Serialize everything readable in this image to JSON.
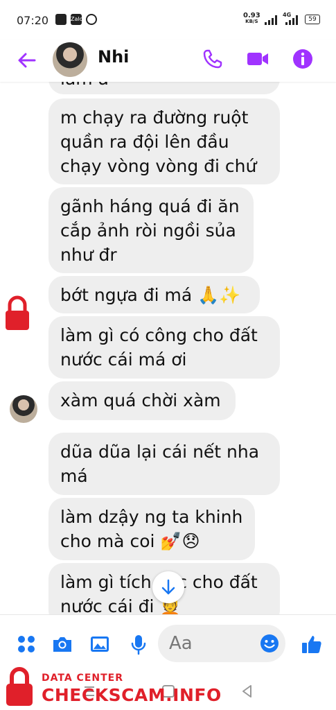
{
  "status_bar": {
    "time": "07:20",
    "net_speed_value": "0.93",
    "net_speed_unit": "KB/S",
    "network_type": "4G",
    "battery": "59"
  },
  "header": {
    "contact_name": "Nhi",
    "accent_color": "#a033ff"
  },
  "messages": [
    {
      "text": "làm á"
    },
    {
      "text": "m chạy ra đường ruột\nquần ra đội lên đầu\nchạy vòng vòng đi chứ"
    },
    {
      "text": "gãnh háng quá đi ăn\ncắp ảnh ròi ngồi sủa\nnhư đr"
    },
    {
      "text": "bớt ngựa đi má 🙏✨"
    },
    {
      "text": "làm gì có công cho đất\nnước cái má ơi"
    },
    {
      "text": "xàm quá chời xàm"
    },
    {
      "text": "dũa dũa lại cái nết nha\nmá"
    },
    {
      "text": "làm dzậy ng ta khinh\ncho mà coi 💅😞"
    },
    {
      "text": "làm gì tích cực cho đất\nnước cái đi 💆"
    }
  ],
  "composer": {
    "placeholder": "Aa",
    "icons": [
      "menu-icon",
      "camera-icon",
      "gallery-icon",
      "microphone-icon",
      "emoji-icon",
      "like-icon"
    ]
  },
  "watermark": {
    "small_text": "DATA CENTER",
    "big_text": "CHECKSCAM.INFO",
    "color": "#e0202a"
  }
}
